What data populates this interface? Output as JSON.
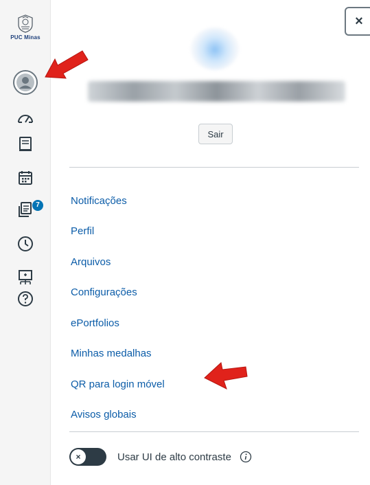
{
  "rail": {
    "logo_text": "PUC Minas",
    "items": [
      {
        "icon": "user-avatar-icon"
      },
      {
        "icon": "dashboard-icon"
      },
      {
        "icon": "courses-icon"
      },
      {
        "icon": "calendar-icon"
      },
      {
        "icon": "inbox-icon",
        "badge": "7"
      },
      {
        "icon": "history-icon"
      },
      {
        "icon": "commons-icon"
      },
      {
        "icon": "help-icon"
      }
    ]
  },
  "tray": {
    "close_label": "×",
    "logout_label": "Sair",
    "menu": [
      "Notificações",
      "Perfil",
      "Arquivos",
      "Configurações",
      "ePortfolios",
      "Minhas medalhas",
      "QR para login móvel",
      "Avisos globais"
    ],
    "toggle_knob": "×",
    "high_contrast_label": "Usar UI de alto contraste"
  },
  "colors": {
    "link": "#0b5ca8",
    "text": "#2d3b45",
    "rail_bg": "#f5f5f5",
    "badge": "#0374b5",
    "annotation": "#e0221b"
  }
}
